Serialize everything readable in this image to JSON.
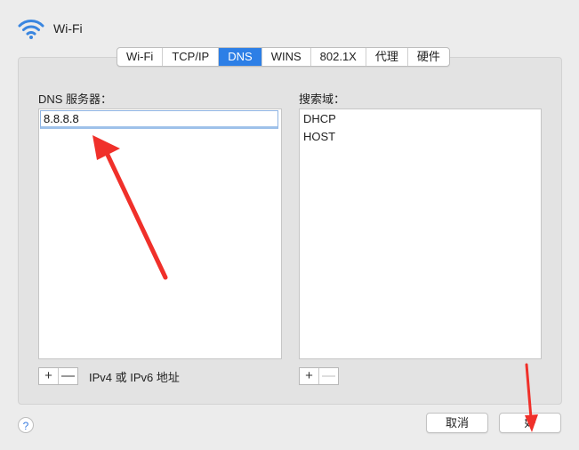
{
  "window": {
    "title": "Wi-Fi"
  },
  "tabs": [
    {
      "label": "Wi-Fi",
      "active": false
    },
    {
      "label": "TCP/IP",
      "active": false
    },
    {
      "label": "DNS",
      "active": true
    },
    {
      "label": "WINS",
      "active": false
    },
    {
      "label": "802.1X",
      "active": false
    },
    {
      "label": "代理",
      "active": false
    },
    {
      "label": "硬件",
      "active": false
    }
  ],
  "dns": {
    "label": "DNS 服务器：",
    "servers": [
      "8.8.8.8"
    ],
    "footnote": "IPv4 或 IPv6 地址"
  },
  "search_domains": {
    "label": "搜索域：",
    "items": [
      "DHCP",
      "HOST"
    ]
  },
  "controls": {
    "plus": "+",
    "minus": "—",
    "help": "?"
  },
  "buttons": {
    "cancel": "取消",
    "ok": "好"
  },
  "colors": {
    "accent": "#2d7fe6",
    "annotation_arrow": "#f0302a",
    "panel": "#e3e3e3"
  }
}
